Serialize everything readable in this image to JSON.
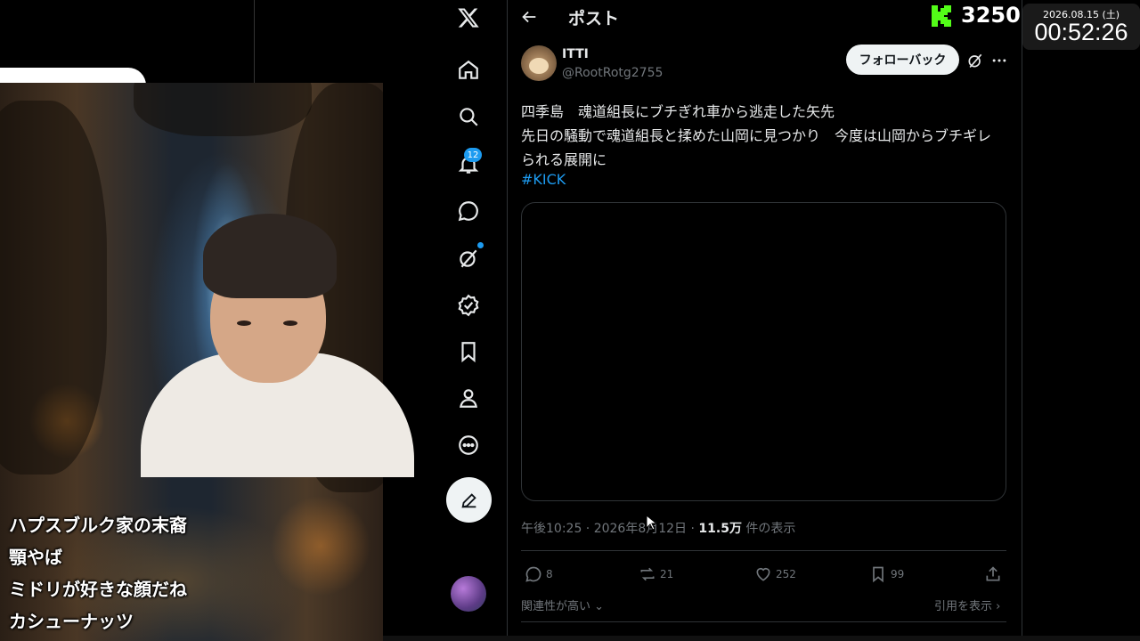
{
  "header": {
    "title": "ポスト"
  },
  "kick": {
    "count": "3250",
    "color": "#53fc18"
  },
  "clock": {
    "date": "2026.08.15 (土)",
    "time": "00:52:26"
  },
  "nav": {
    "icons": [
      "x-logo-icon",
      "home-icon",
      "search-icon",
      "bell-icon",
      "messages-icon",
      "grok-icon",
      "verified-icon",
      "bookmark-icon",
      "profile-icon",
      "more-icon"
    ],
    "notification_count": "12"
  },
  "post": {
    "author_name": "ITTI",
    "author_handle": "@RootRotg2755",
    "follow_label": "フォローバック",
    "lines": [
      "四季島　魂道組長にブチぎれ車から逃走した矢先",
      "先日の騒動で魂道組長と揉めた山岡に見つかり　今度は山岡からブチギレ",
      "られる展開に"
    ],
    "hashtag": "#KICK",
    "timestamp": "午後10:25 · 2026年8月12日 · ",
    "views": "11.5万",
    "views_suffix": " 件の表示",
    "replies": "8",
    "reposts": "21",
    "likes": "252",
    "bookmarks": "99",
    "sort_label": "関連性が高い",
    "quotes_label": "引用を表示"
  },
  "captions": [
    "ハプスブルク家の末裔",
    "顎やば",
    "ミドリが好きな顔だね",
    "カシューナッツ"
  ],
  "colors": {
    "accent": "#1d9bf0",
    "background": "#000000",
    "text": "#e7e9ea",
    "muted": "#71767b"
  }
}
